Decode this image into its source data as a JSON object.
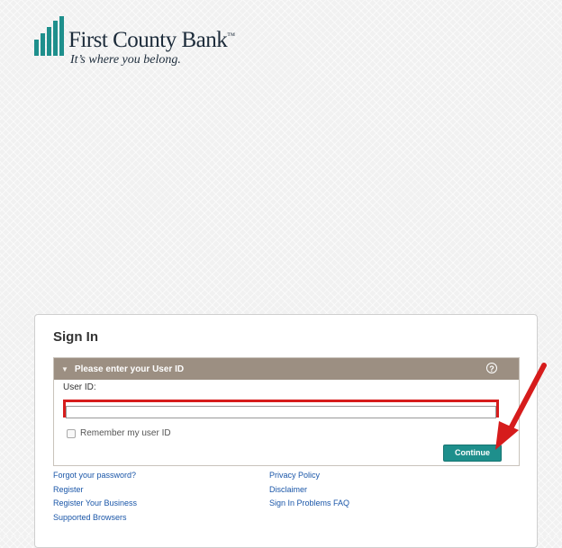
{
  "brand": {
    "name": "First County Bank",
    "tm": "™",
    "tagline": "It’s where you belong.",
    "colors": {
      "navy": "#1c2b3a",
      "teal": "#1e8f8c"
    }
  },
  "signin": {
    "title": "Sign In",
    "panel_title": "Please enter your User ID",
    "help_icon": "?",
    "user_id_label": "User ID:",
    "user_id_value": "",
    "remember_label": "Remember my user ID",
    "remember_checked": false,
    "continue_label": "Continue"
  },
  "links": {
    "left": [
      "Forgot your password?",
      "Register",
      "Register Your Business",
      "Supported Browsers"
    ],
    "right": [
      "Privacy Policy",
      "Disclaimer",
      "Sign In Problems FAQ"
    ]
  },
  "annotation": {
    "highlight_color": "#d61c1c",
    "arrow_color": "#d61c1c"
  }
}
